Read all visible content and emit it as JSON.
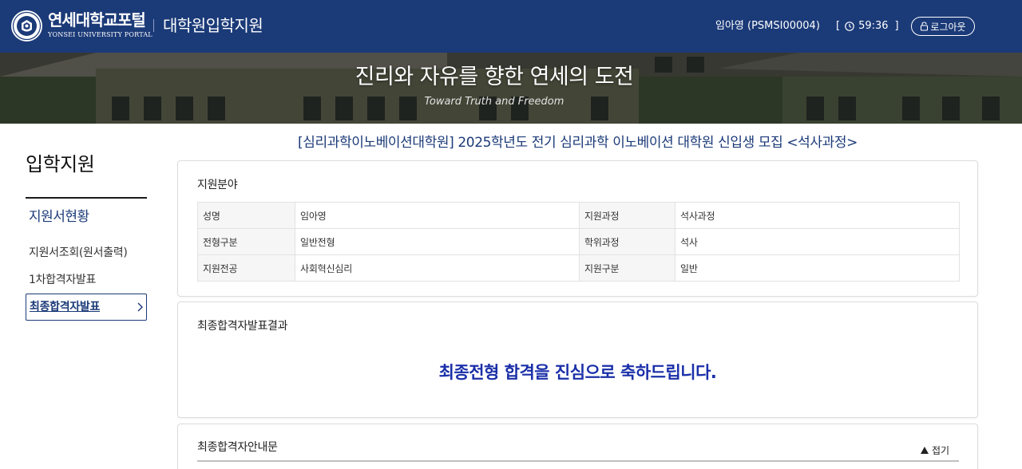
{
  "header": {
    "brand_name": "연세대학교포털",
    "brand_sub": "YONSEI UNIVERSITY PORTAL",
    "app_title": "대학원입학지원",
    "user": "임아영 (PSMSI00004)",
    "timer_open": "[",
    "timer": "59:36",
    "timer_close": "]",
    "logout_label": "로그아웃",
    "icons": [
      "yonsei-logo",
      "clock-icon",
      "lock-icon"
    ],
    "colors": {
      "primary": "#1b3a78",
      "text_on_primary": "#ffffff"
    }
  },
  "banner": {
    "title": "진리와 자유를 향한 연세의 도전",
    "subtitle": "Toward Truth and Freedom"
  },
  "sidebar": {
    "heading": "입학지원",
    "section": "지원서현황",
    "items": [
      {
        "label": "지원서조회(원서출력)"
      },
      {
        "label": "1차합격자발표"
      },
      {
        "label": "최종합격자발표",
        "active": true
      }
    ]
  },
  "main": {
    "title": "[심리과학이노베이션대학원] 2025학년도 전기 심리과학 이노베이션 대학원 신입생 모집 <석사과정>",
    "application": {
      "title": "지원분야",
      "rows": [
        {
          "k1": "성명",
          "v1": "임아영",
          "k2": "지원과정",
          "v2": "석사과정"
        },
        {
          "k1": "전형구분",
          "v1": "일반전형",
          "k2": "학위과정",
          "v2": "석사"
        },
        {
          "k1": "지원전공",
          "v1": "사회혁신심리",
          "k2": "지원구분",
          "v2": "일반"
        }
      ]
    },
    "result": {
      "title": "최종합격자발표결과",
      "message": "최종전형 합격을 진심으로 축하드립니다.",
      "message_color": "#1a2fa8"
    },
    "guide": {
      "title": "최종합격자안내문",
      "fold_label": "접기"
    }
  }
}
